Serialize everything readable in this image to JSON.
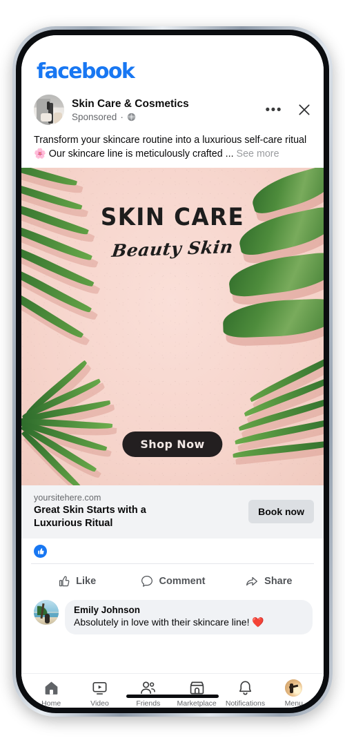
{
  "app": {
    "brand": "facebook"
  },
  "post": {
    "page_name": "Skin Care & Cosmetics",
    "sponsored_label": "Sponsored",
    "separator": "·",
    "globe_icon": "globe-icon",
    "more_icon": "ellipsis-icon",
    "close_icon": "close-icon",
    "body_text": "Transform your skincare routine into a luxurious self-care ritual 🌸 Our skincare line is meticulously crafted ...",
    "see_more": "See more"
  },
  "creative": {
    "headline": "SKIN CARE",
    "subhead": "Beauty Skin",
    "cta": "Shop Now",
    "bg_color": "#f6d4cb",
    "ink_color": "#1d1d1d"
  },
  "caption": {
    "url": "yoursitehere.com",
    "title_line1": "Great Skin Starts with a",
    "title_line2": "Luxurious Ritual",
    "button": "Book now"
  },
  "engagement": {
    "reaction_icon": "thumbs-up-icon",
    "reaction_color": "#1877F2",
    "actions": [
      {
        "label": "Like",
        "icon": "thumbs-up-outline-icon"
      },
      {
        "label": "Comment",
        "icon": "comment-bubble-icon"
      },
      {
        "label": "Share",
        "icon": "share-arrow-icon"
      }
    ]
  },
  "comment": {
    "author": "Emily Johnson",
    "text": "Absolutely in love with their skincare line! ❤️"
  },
  "nav": {
    "items": [
      {
        "label": "Home",
        "icon": "home-icon"
      },
      {
        "label": "Video",
        "icon": "video-icon"
      },
      {
        "label": "Friends",
        "icon": "friends-icon"
      },
      {
        "label": "Marketplace",
        "icon": "marketplace-icon"
      },
      {
        "label": "Notifications",
        "icon": "bell-icon"
      },
      {
        "label": "Menu",
        "icon": "profile-avatar-icon"
      }
    ]
  }
}
